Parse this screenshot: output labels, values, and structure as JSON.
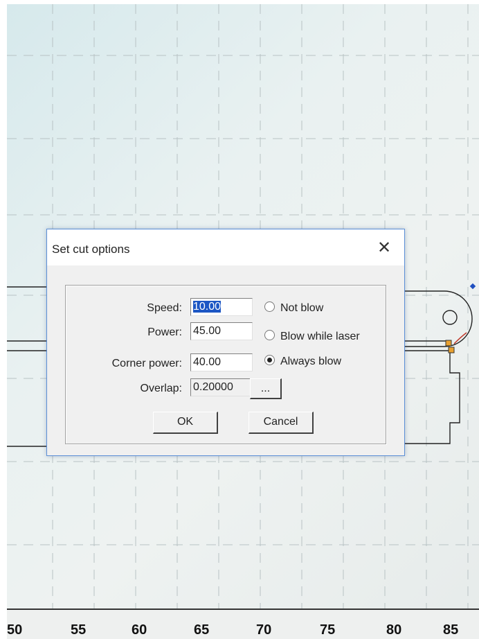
{
  "dialog": {
    "title": "Set cut options",
    "close_glyph": "✕",
    "fields": [
      {
        "label": "Speed:",
        "value": "10.00"
      },
      {
        "label": "Power:",
        "value": "45.00"
      },
      {
        "label": "Corner power:",
        "value": "40.00"
      },
      {
        "label": "Overlap:",
        "value": "0.20000"
      }
    ],
    "blow_options": [
      {
        "label": "Not blow",
        "selected": false
      },
      {
        "label": "Blow while laser",
        "selected": false
      },
      {
        "label": "Always blow",
        "selected": true
      }
    ],
    "browse_label": "...",
    "ok_label": "OK",
    "cancel_label": "Cancel"
  },
  "ruler": {
    "ticks": [
      "50",
      "55",
      "60",
      "65",
      "70",
      "75",
      "80",
      "85"
    ]
  },
  "colors": {
    "selection": "#1c56c4",
    "dialog_border": "#5b8fd6",
    "marker": "#e8a030"
  }
}
